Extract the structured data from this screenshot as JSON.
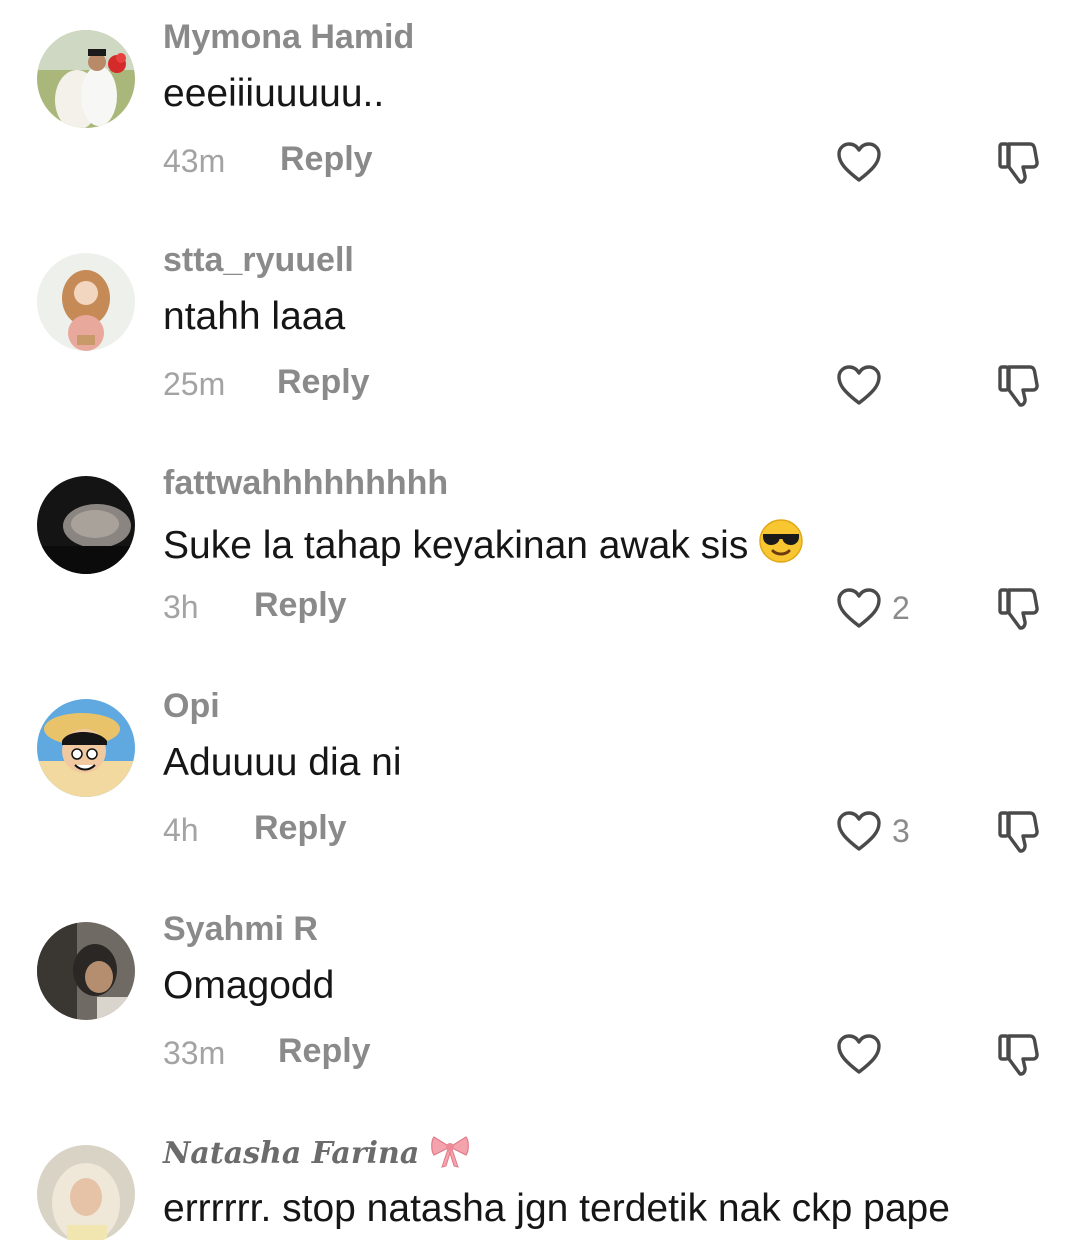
{
  "comments": [
    {
      "username": "Mymona Hamid",
      "text": "eeeiiiuuuuu..",
      "time": "43m",
      "reply_label": "Reply",
      "likes": ""
    },
    {
      "username": "stta_ryuuell",
      "text": "ntahh laaa",
      "time": "25m",
      "reply_label": "Reply",
      "likes": ""
    },
    {
      "username": "fattwahhhhhhhhh",
      "text": "Suke la tahap keyakinan awak sis",
      "emoji": "sunglasses-emoji",
      "time": "3h",
      "reply_label": "Reply",
      "likes": "2"
    },
    {
      "username": "Opi",
      "text": "Aduuuu dia ni",
      "time": "4h",
      "reply_label": "Reply",
      "likes": "3"
    },
    {
      "username": "Syahmi R",
      "text": "Omagodd",
      "time": "33m",
      "reply_label": "Reply",
      "likes": ""
    },
    {
      "username": "Natasha Farina",
      "username_decoration": "ribbon-bow-emoji",
      "text": "errrrrr. stop natasha jgn terdetik nak ckp pape",
      "time": "",
      "reply_label": "",
      "likes": ""
    }
  ],
  "icons": {
    "like": "heart-outline-icon",
    "dislike": "thumbs-down-outline-icon"
  },
  "colors": {
    "username": "#8a8a8a",
    "text": "#161616",
    "meta": "#a3a3a3",
    "icon": "#4a4a4a"
  }
}
